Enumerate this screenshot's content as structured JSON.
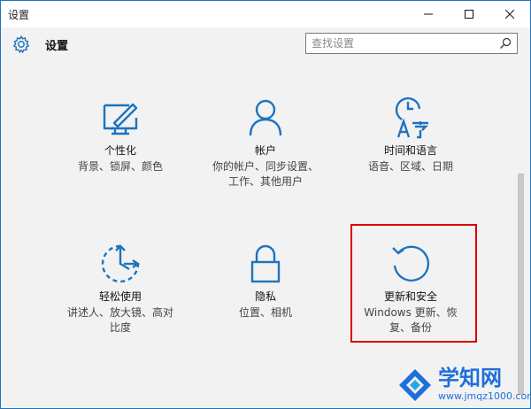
{
  "window": {
    "title": "设置",
    "controls": {
      "minimize_icon": "minimize-icon",
      "maximize_icon": "maximize-icon",
      "close_icon": "close-icon"
    }
  },
  "header": {
    "title": "设置",
    "icon": "gear-icon",
    "search": {
      "placeholder": "查找设置",
      "value": "",
      "icon": "search-icon"
    }
  },
  "categories": [
    {
      "name": "个性化",
      "desc_lines": [
        "背景、锁屏、颜色"
      ],
      "icon": "personalization-icon"
    },
    {
      "name": "帐户",
      "desc_lines": [
        "你的帐户、同步设置、",
        "工作、其他用户"
      ],
      "icon": "account-icon"
    },
    {
      "name": "时间和语言",
      "desc_lines": [
        "语音、区域、日期"
      ],
      "icon": "time-language-icon"
    },
    {
      "name": "轻松使用",
      "desc_lines": [
        "讲述人、放大镜、高对",
        "比度"
      ],
      "icon": "ease-of-access-icon"
    },
    {
      "name": "隐私",
      "desc_lines": [
        "位置、相机"
      ],
      "icon": "privacy-lock-icon"
    },
    {
      "name": "更新和安全",
      "desc_lines": [
        "Windows 更新、恢",
        "复、备份"
      ],
      "icon": "update-security-icon"
    }
  ],
  "watermark": {
    "text": "学知网",
    "url": "www.jmqz1000.com"
  },
  "colors": {
    "accent": "#1e73be",
    "highlight": "#d80000",
    "background": "#f2f2f2"
  }
}
